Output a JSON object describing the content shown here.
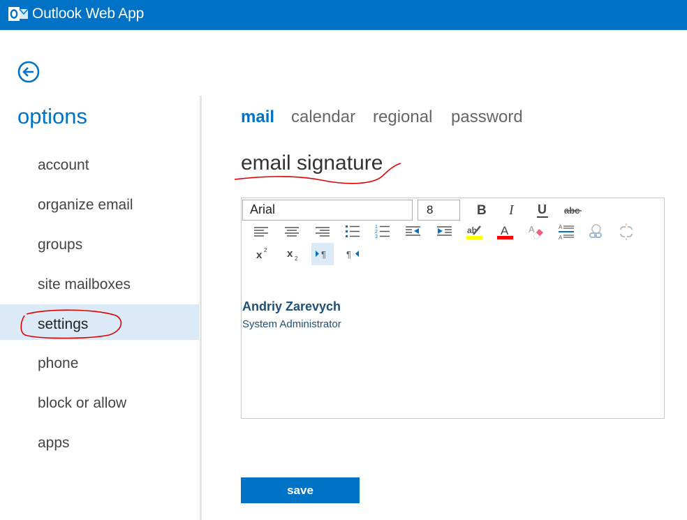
{
  "app": {
    "title": "Outlook Web App",
    "logo_icon": "outlook-logo-icon",
    "accent": "#0072c6"
  },
  "back": {
    "icon": "back-arrow-icon"
  },
  "sidebar": {
    "title": "options",
    "items": [
      {
        "label": "account"
      },
      {
        "label": "organize email"
      },
      {
        "label": "groups"
      },
      {
        "label": "site mailboxes"
      },
      {
        "label": "settings",
        "selected": true
      },
      {
        "label": "phone"
      },
      {
        "label": "block or allow"
      },
      {
        "label": "apps"
      }
    ]
  },
  "tabs": [
    {
      "label": "mail",
      "active": true
    },
    {
      "label": "calendar"
    },
    {
      "label": "regional"
    },
    {
      "label": "password"
    }
  ],
  "section": {
    "title": "email signature"
  },
  "editor": {
    "font": "Arial",
    "size": "8",
    "toolbar_icons": [
      "bold-icon",
      "italic-icon",
      "underline-icon",
      "strikethrough-icon",
      "align-left-icon",
      "align-center-icon",
      "align-right-icon",
      "bulleted-list-icon",
      "numbered-list-icon",
      "decrease-indent-icon",
      "increase-indent-icon",
      "highlight-icon",
      "font-color-icon",
      "clear-formatting-icon",
      "paragraph-style-icon",
      "insert-link-icon",
      "remove-link-icon",
      "superscript-icon",
      "subscript-icon",
      "ltr-icon",
      "rtl-icon"
    ],
    "highlight_color": "#ffff00",
    "font_color": "#ff0000",
    "signature": {
      "name": "Andriy Zarevych",
      "title": "System Administrator"
    }
  },
  "actions": {
    "save_label": "save"
  },
  "annotation_color": "#e00000"
}
